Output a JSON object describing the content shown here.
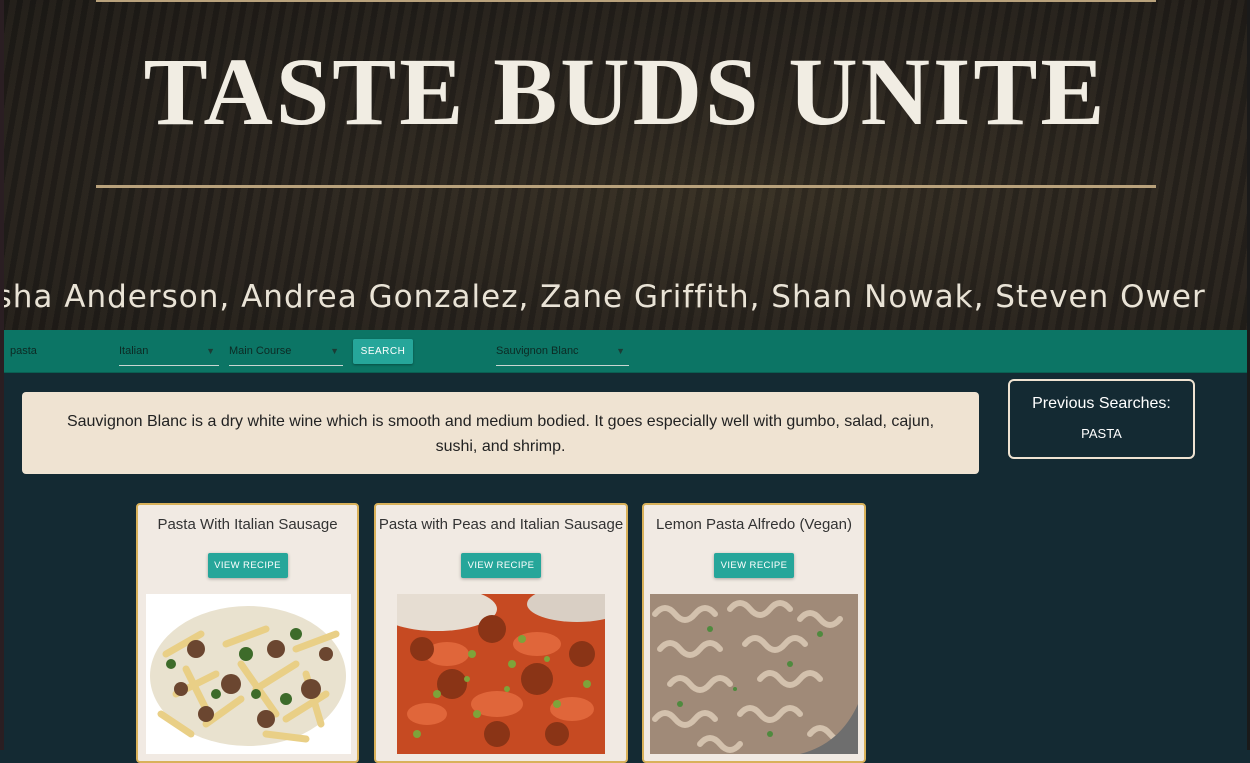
{
  "header": {
    "title": "TASTE BUDS UNITE",
    "authors": "isha Anderson, Andrea Gonzalez, Zane Griffith, Shan Nowak, Steven Ower"
  },
  "search": {
    "query": "pasta",
    "cuisine": "Italian",
    "course": "Main Course",
    "search_label": "SEARCH",
    "wine": "Sauvignon Blanc"
  },
  "wine_pairing": {
    "text": "Sauvignon Blanc is a dry white wine which is smooth and medium bodied. It goes especially well with gumbo, salad, cajun, sushi, and shrimp."
  },
  "previous_searches": {
    "title": "Previous Searches:",
    "items": [
      "PASTA"
    ]
  },
  "recipes": [
    {
      "title": "Pasta With Italian Sausage",
      "button": "VIEW RECIPE",
      "image": "penne-sausage-broccoli-photo"
    },
    {
      "title": "Pasta with Peas and Italian Sausage",
      "button": "VIEW RECIPE",
      "image": "farfalle-meatballs-peas-photo"
    },
    {
      "title": "Lemon Pasta Alfredo (Vegan)",
      "button": "VIEW RECIPE",
      "image": "fusilli-alfredo-photo"
    }
  ],
  "colors": {
    "background": "#142a33",
    "navbar": "#0c7565",
    "button": "#26a69a",
    "cream": "#efe3d2",
    "card_border": "#d9b15a"
  }
}
